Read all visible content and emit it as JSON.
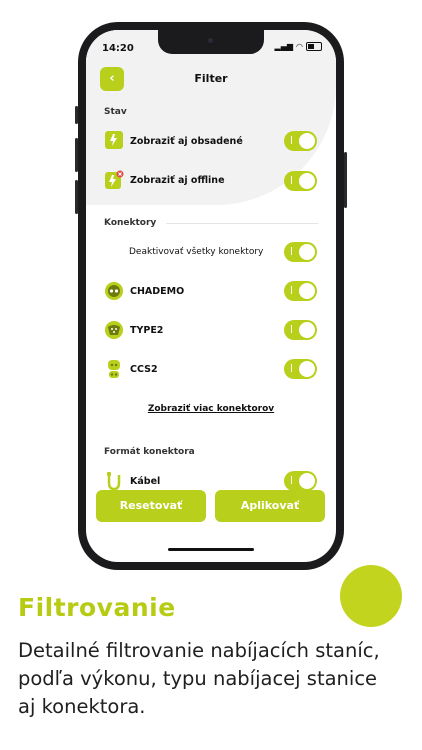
{
  "status_bar": {
    "time": "14:20"
  },
  "header": {
    "back_icon": "chevron-left-icon",
    "title": "Filter"
  },
  "stav": {
    "section_title": "Stav",
    "items": [
      {
        "label": "Zobraziť aj obsadené",
        "icon": "charger-occupied-icon",
        "enabled": true
      },
      {
        "label": "Zobraziť aj offline",
        "icon": "charger-offline-icon",
        "enabled": true
      }
    ]
  },
  "konektory": {
    "section_title": "Konektory",
    "deactivate_all": {
      "label": "Deaktivovať všetky konektory",
      "enabled": true
    },
    "items": [
      {
        "label": "CHADEMO",
        "icon": "chademo-connector-icon",
        "enabled": true
      },
      {
        "label": "TYPE2",
        "icon": "type2-connector-icon",
        "enabled": true
      },
      {
        "label": "CCS2",
        "icon": "ccs2-connector-icon",
        "enabled": true
      }
    ],
    "more_link": "Zobraziť viac konektorov"
  },
  "format": {
    "section_title": "Formát konektora",
    "items": [
      {
        "label": "Kábel",
        "icon": "cable-icon",
        "enabled": true
      }
    ]
  },
  "actions": {
    "reset": "Resetovať",
    "apply": "Aplikovať"
  },
  "caption": {
    "title": "Filtrovanie",
    "text": "Detailné filtrovanie nabíjacích staníc, podľa výkonu, typu nabíjacej stanice aj konektora."
  },
  "colors": {
    "accent": "#b8cf1c"
  }
}
